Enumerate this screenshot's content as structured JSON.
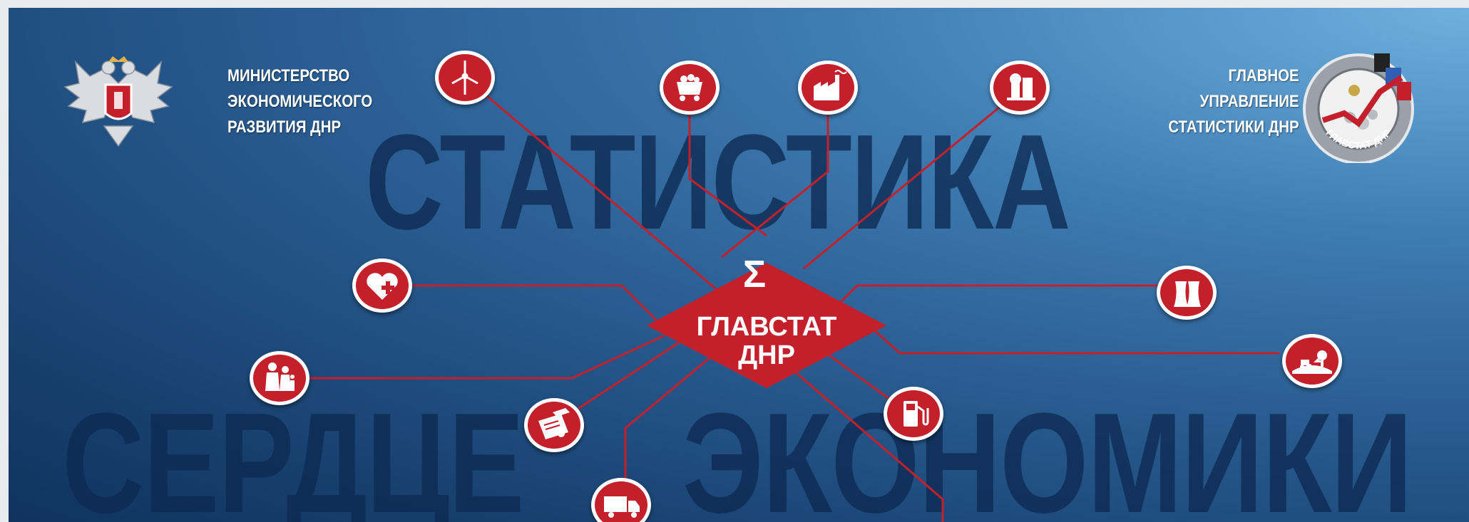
{
  "banner": {
    "big_word_top": "СТАТИСТИКА",
    "big_word_left": "СЕРДЦЕ",
    "big_word_right": "ЭКОНОМИКИ",
    "ministry_lines": [
      "МИНИСТЕРСТВО",
      "ЭКОНОМИЧЕСКОГО",
      "РАЗВИТИЯ ДНР"
    ],
    "glavnoe_lines": [
      "ГЛАВНОЕ",
      "УПРАВЛЕНИЕ",
      "СТАТИСТИКИ ДНР"
    ],
    "center_symbol": "Σ",
    "center_lines": [
      "ГЛАВСТАТ",
      "ДНР"
    ],
    "logo_ring_text": "ГЛАВСТАТ ДНР",
    "icons": [
      "wind-turbine-icon",
      "mine-cart-icon",
      "factory-icon",
      "chemical-plant-icon",
      "heart-plus-icon",
      "family-icon",
      "diploma-icon",
      "truck-icon",
      "fuel-pump-icon",
      "cooling-towers-icon",
      "farm-icon"
    ],
    "colors": {
      "accent_red": "#c4202b",
      "text_white": "#ffffff",
      "big_text": "#0d2a52",
      "bg_light": "#6fb0de",
      "bg_dark": "#10335e"
    }
  }
}
